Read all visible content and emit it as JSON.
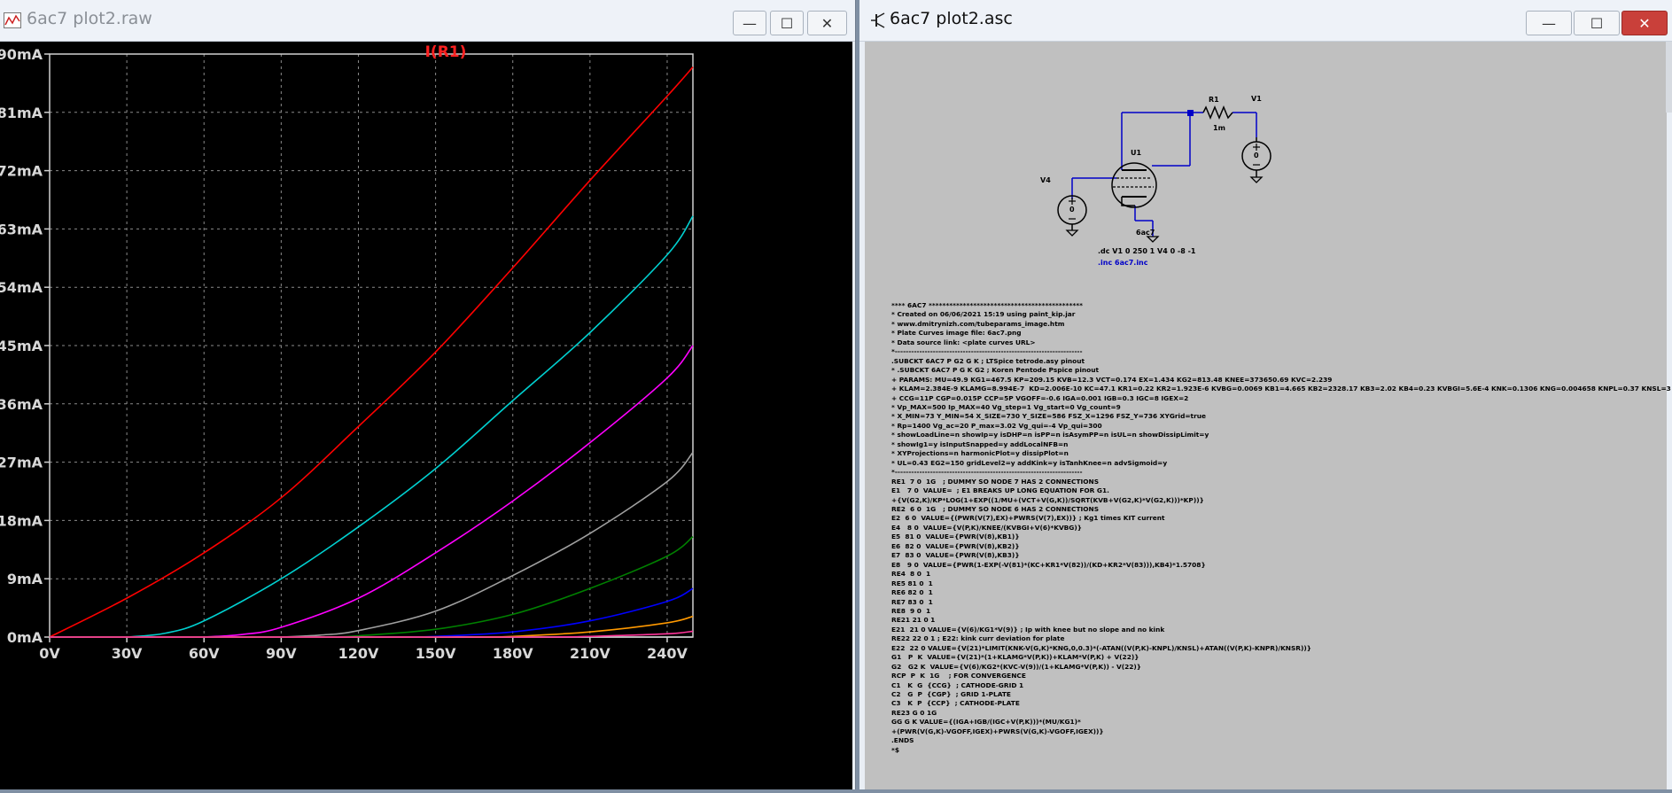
{
  "plot_window": {
    "title": "6ac7 plot2.raw",
    "buttons": {
      "minimize": "—",
      "maximize": "☐",
      "close": "✕"
    }
  },
  "schematic_window": {
    "title": "6ac7 plot2.asc",
    "buttons": {
      "minimize": "—",
      "maximize": "☐",
      "close": "✕"
    }
  },
  "chart_data": {
    "type": "line",
    "title": "I(R1)",
    "xlabel": "",
    "ylabel": "",
    "xlim": [
      0,
      250
    ],
    "ylim": [
      0,
      90
    ],
    "x_ticks": [
      "0V",
      "30V",
      "60V",
      "90V",
      "120V",
      "150V",
      "180V",
      "210V",
      "240V"
    ],
    "y_ticks": [
      "0mA",
      "9mA",
      "18mA",
      "27mA",
      "36mA",
      "45mA",
      "54mA",
      "63mA",
      "72mA",
      "81mA",
      "90mA"
    ],
    "grid": true,
    "series": [
      {
        "color": "#ff0000",
        "x": [
          0,
          30,
          60,
          90,
          120,
          150,
          180,
          210,
          240,
          250
        ],
        "y": [
          0,
          6,
          13,
          21.5,
          32.5,
          44,
          57,
          70.5,
          83.5,
          88
        ]
      },
      {
        "color": "#00d0d0",
        "x": [
          30,
          45,
          60,
          90,
          120,
          150,
          180,
          210,
          240,
          250
        ],
        "y": [
          0,
          0.6,
          2.5,
          9,
          17,
          26,
          36.5,
          47,
          59,
          65
        ]
      },
      {
        "color": "#ff00ff",
        "x": [
          60,
          75,
          90,
          120,
          150,
          180,
          210,
          240,
          250
        ],
        "y": [
          0,
          0.4,
          1.5,
          6,
          13,
          21,
          30,
          40,
          45
        ]
      },
      {
        "color": "#a0a0a0",
        "x": [
          90,
          105,
          120,
          150,
          180,
          210,
          240,
          250
        ],
        "y": [
          0,
          0.3,
          1,
          4,
          9.5,
          16,
          24,
          28.5
        ]
      },
      {
        "color": "#008000",
        "x": [
          110,
          120,
          150,
          180,
          210,
          240,
          250
        ],
        "y": [
          0,
          0.2,
          1.2,
          3.5,
          7.5,
          12.5,
          15.5
        ]
      },
      {
        "color": "#0000ff",
        "x": [
          140,
          150,
          180,
          210,
          240,
          250
        ],
        "y": [
          0,
          0.1,
          0.8,
          2.5,
          5.5,
          7.5
        ]
      },
      {
        "color": "#ff9900",
        "x": [
          170,
          180,
          210,
          240,
          250
        ],
        "y": [
          0,
          0.1,
          0.8,
          2.2,
          3.2
        ]
      },
      {
        "color": "#ff3399",
        "x": [
          195,
          210,
          240,
          250
        ],
        "y": [
          0,
          0.1,
          0.5,
          0.9
        ]
      }
    ]
  },
  "schematic": {
    "labels": {
      "r1": "R1",
      "r1_value": "1m",
      "v1": "V1",
      "v1_value": "0",
      "v4": "V4",
      "v4_value": "0",
      "u1": "U1",
      "u1_model": "6ac7"
    },
    "directives": {
      "dc": ".dc V1 0 250 1 V4 0 -8 -1",
      "include": ".inc 6ac7.inc"
    },
    "netlist": "**** 6AC7 *********************************************\n* Created on 06/06/2021 15:19 using paint_kip.jar\n* www.dmitrynizh.com/tubeparams_image.htm\n* Plate Curves image file: 6ac7.png\n* Data source link: <plate curves URL>\n*---------------------------------------------------------------------\n.SUBCKT 6AC7 P G2 G K ; LTSpice tetrode.asy pinout\n* .SUBCKT 6AC7 P G K G2 ; Koren Pentode Pspice pinout\n+ PARAMS: MU=49.9 KG1=467.5 KP=209.15 KVB=12.3 VCT=0.174 EX=1.434 KG2=813.48 KNEE=373650.69 KVC=2.239\n+ KLAM=2.384E-9 KLAMG=8.994E-7  KD=2.006E-10 KC=47.1 KR1=0.22 KR2=1.923E-6 KVBG=0.0069 KB1=4.665 KB2=2328.17 KB3=2.02 KB4=0.23 KVBGI=5.6E-4 KNK=0.1306 KNG=0.004658 KNPL=0.37 KNSL=3\n+ CCG=11P CGP=0.015P CCP=5P VGOFF=-0.6 IGA=0.001 IGB=0.3 IGC=8 IGEX=2\n* Vp_MAX=500 Ip_MAX=40 Vg_step=1 Vg_start=0 Vg_count=9\n* X_MIN=73 Y_MIN=54 X_SIZE=730 Y_SIZE=586 FSZ_X=1296 FSZ_Y=736 XYGrid=true\n* Rp=1400 Vg_ac=20 P_max=3.02 Vg_qui=-4 Vp_qui=300\n* showLoadLine=n showIp=y isDHP=n isPP=n isAsymPP=n isUL=n showDissipLimit=y\n* showIg1=y isInputSnapped=y addLocalNFB=n\n* XYProjections=n harmonicPlot=y dissipPlot=n\n* UL=0.43 EG2=150 gridLevel2=y addKink=y isTanhKnee=n advSigmoid=y\n*---------------------------------------------------------------------\nRE1  7 0  1G   ; DUMMY SO NODE 7 HAS 2 CONNECTIONS\nE1   7 0  VALUE=  ; E1 BREAKS UP LONG EQUATION FOR G1.\n+{V(G2,K)/KP*LOG(1+EXP((1/MU+(VCT+V(G,K))/SQRT(KVB+V(G2,K)*V(G2,K)))*KP))}\nRE2  6 0  1G   ; DUMMY SO NODE 6 HAS 2 CONNECTIONS\nE2  6 0  VALUE={(PWR(V(7),EX)+PWRS(V(7),EX))} ; Kg1 times KIT current\nE4   8 0  VALUE={V(P,K)/KNEE/(KVBGI+V(6)*KVBG)}\nE5  81 0  VALUE={PWR(V(8),KB1)}\nE6  82 0  VALUE={PWR(V(8),KB2)}\nE7  83 0  VALUE={PWR(V(8),KB3)}\nE8   9 0  VALUE={PWR(1-EXP(-V(81)*(KC+KR1*V(82))/(KD+KR2*V(83))),KB4)*1.5708}\nRE4  8 0  1\nRE5 81 0  1\nRE6 82 0  1\nRE7 83 0  1\nRE8  9 0  1\nRE21 21 0 1\nE21  21 0 VALUE={V(6)/KG1*V(9)} ; Ip with knee but no slope and no kink\nRE22 22 0 1 ; E22: kink curr deviation for plate\nE22  22 0 VALUE={V(21)*LIMIT(KNK-V(G,K)*KNG,0,0.3)*(-ATAN((V(P,K)-KNPL)/KNSL)+ATAN((V(P,K)-KNPR)/KNSR))}\nG1   P  K  VALUE={V(21)*(1+KLAMG*V(P,K))+KLAM*V(P,K) + V(22)}\nG2   G2 K  VALUE={V(6)/KG2*(KVC-V(9))/(1+KLAMG*V(P,K)) - V(22)}\nRCP  P  K  1G    ; FOR CONVERGENCE\nC1   K  G  {CCG}  ; CATHODE-GRID 1\nC2   G  P  {CGP}  ; GRID 1-PLATE\nC3   K  P  {CCP}  ; CATHODE-PLATE\nRE23 G 0 1G\nGG G K VALUE={(IGA+IGB/(IGC+V(P,K)))*(MU/KG1)*\n+(PWR(V(G,K)-VGOFF,IGEX)+PWRS(V(G,K)-VGOFF,IGEX))}\n.ENDS\n*$"
  }
}
